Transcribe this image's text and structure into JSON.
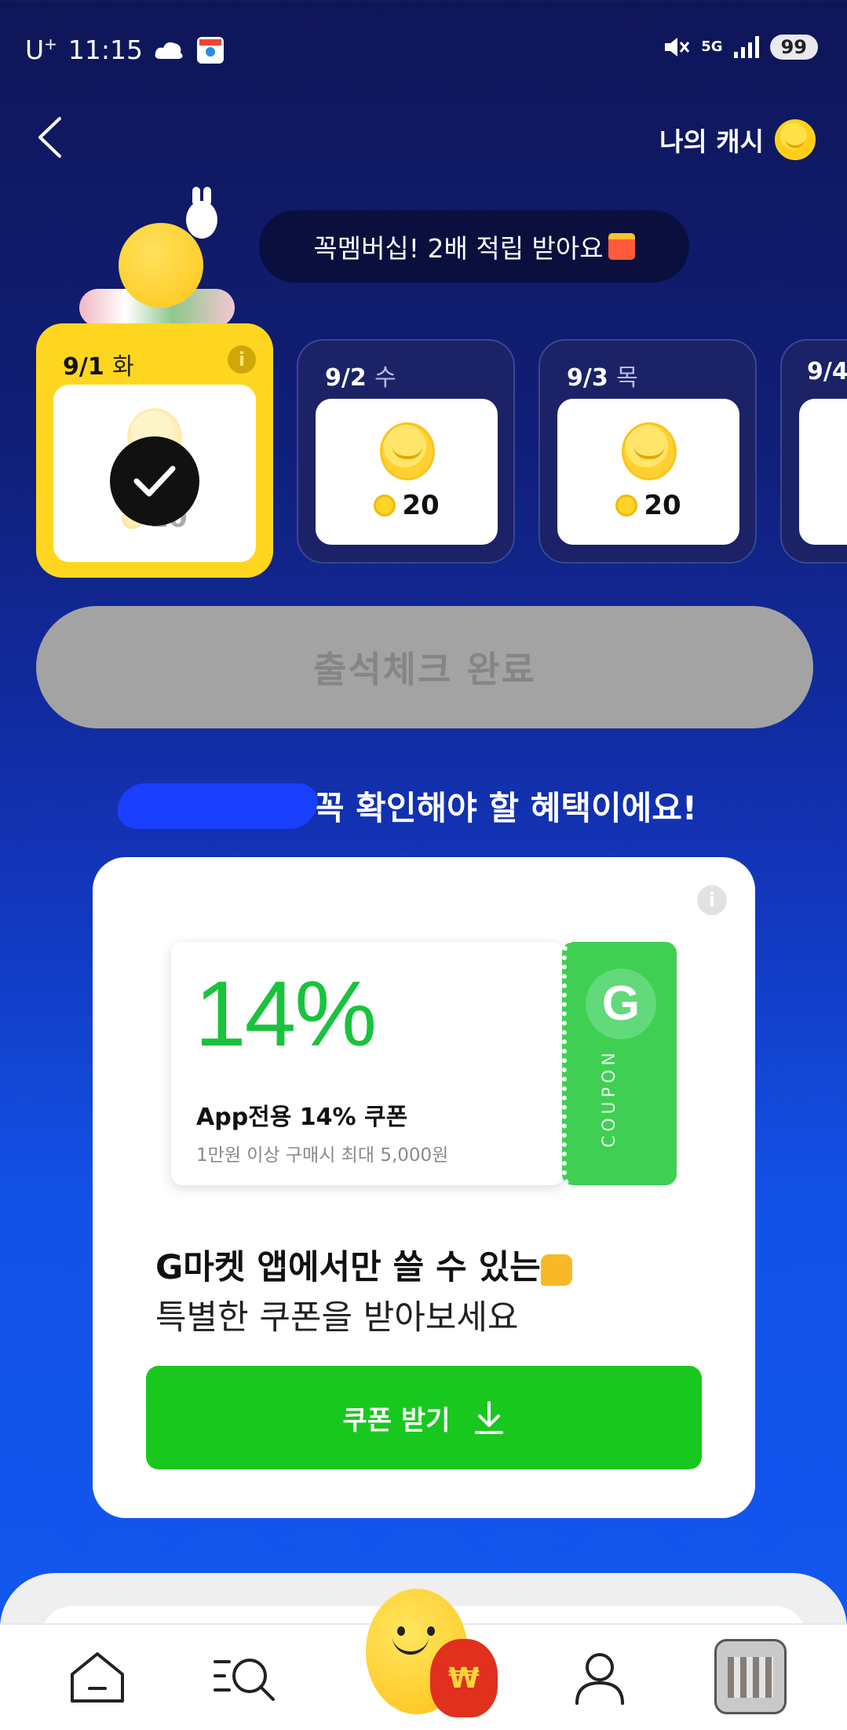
{
  "status_bar": {
    "carrier": "U",
    "carrier_sup": "+",
    "time": "11:15",
    "network": "5G",
    "battery": "99"
  },
  "header": {
    "my_cash_label": "나의 캐시"
  },
  "bubble": {
    "text": "꼭멤버십! 2배 적립 받아요"
  },
  "days": [
    {
      "date": "9/1",
      "dow": "화",
      "amount": "20",
      "checked": true
    },
    {
      "date": "9/2",
      "dow": "수",
      "amount": "20",
      "checked": false
    },
    {
      "date": "9/3",
      "dow": "목",
      "amount": "20",
      "checked": false
    },
    {
      "date": "9/4",
      "dow": "",
      "amount": "",
      "checked": false
    }
  ],
  "attendance_button": "출석체크 완료",
  "section_title": "꼭 확인해야 할 혜택이에요!",
  "coupon": {
    "percent": "14%",
    "name": "App전용 14% 쿠폰",
    "description": "1만원 이상 구매시 최대 5,000원",
    "stub_logo": "G",
    "stub_text": "COUPON",
    "headline": "G마켓 앱에서만 쓸 수 있는",
    "subline": "특별한 쿠폰을 받아보세요",
    "button_label": "쿠폰 받기"
  },
  "bottom_nav": {
    "items": [
      "home-icon",
      "search-icon",
      "cash-mascot",
      "profile-icon",
      "recent-item-thumbnail"
    ],
    "mascot_bag_symbol": "₩"
  },
  "colors": {
    "bg_top": "#0f1658",
    "bg_bottom": "#1257ef",
    "active_card": "#ffd61f",
    "coupon_green": "#19c33c",
    "button_green": "#19c81e",
    "stub_green": "#3fcf52"
  }
}
